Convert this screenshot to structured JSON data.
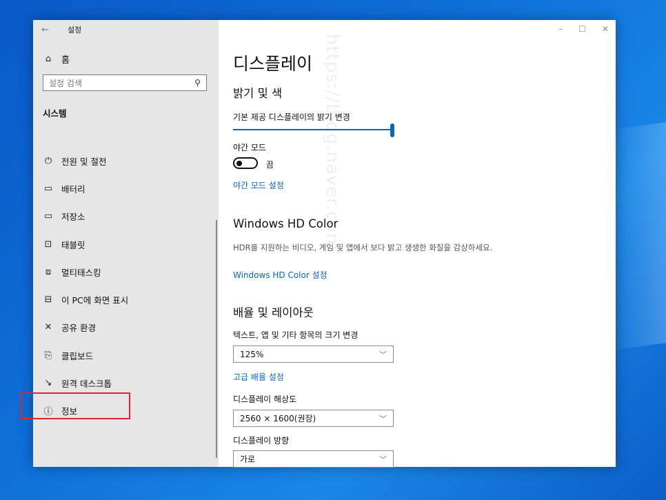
{
  "window": {
    "title": "설정",
    "minimize": "–",
    "maximize": "☐",
    "close": "✕"
  },
  "sidebar": {
    "home_label": "홈",
    "search_placeholder": "설정 검색",
    "section_title": "시스템",
    "items": [
      {
        "label": "전원 및 절전",
        "icon": "power-icon",
        "glyph": "⏻"
      },
      {
        "label": "배터리",
        "icon": "battery-icon",
        "glyph": "▭"
      },
      {
        "label": "저장소",
        "icon": "storage-icon",
        "glyph": "▭"
      },
      {
        "label": "태블릿",
        "icon": "tablet-icon",
        "glyph": "⊡"
      },
      {
        "label": "멀티태스킹",
        "icon": "multitasking-icon",
        "glyph": "⧈"
      },
      {
        "label": "이 PC에 화면 표시",
        "icon": "project-icon",
        "glyph": "⊟"
      },
      {
        "label": "공유 환경",
        "icon": "shared-experiences-icon",
        "glyph": "✕"
      },
      {
        "label": "클립보드",
        "icon": "clipboard-icon",
        "glyph": "⎘"
      },
      {
        "label": "원격 데스크톱",
        "icon": "remote-desktop-icon",
        "glyph": "↘"
      },
      {
        "label": "정보",
        "icon": "info-icon",
        "glyph": "ⓘ"
      }
    ]
  },
  "main": {
    "page_title": "디스플레이",
    "brightness": {
      "heading": "밝기 및 색",
      "label": "기본 제공 디스플레이의 밝기 변경",
      "value": 100
    },
    "night_light": {
      "label": "야간 모드",
      "state": "끔",
      "settings_link": "야간 모드 설정"
    },
    "hd_color": {
      "heading": "Windows HD Color",
      "description": "HDR를 지원하는 비디오, 게임 및 앱에서 보다 밝고 생생한 화질을 감상하세요.",
      "settings_link": "Windows HD Color 설정"
    },
    "scale_layout": {
      "heading": "배율 및 레이아웃",
      "scale_label": "텍스트, 앱 및 기타 항목의 크기 변경",
      "scale_value": "125%",
      "advanced_link": "고급 배율 설정",
      "resolution_label": "디스플레이 해상도",
      "resolution_value": "2560 × 1600(권장)",
      "orientation_label": "디스플레이 방향",
      "orientation_value": "가로"
    }
  },
  "watermark": "https://blog.naver.com",
  "colors": {
    "accent": "#0a66b8",
    "highlight": "#e3262c",
    "sidebar_bg": "#e6e6e6"
  }
}
